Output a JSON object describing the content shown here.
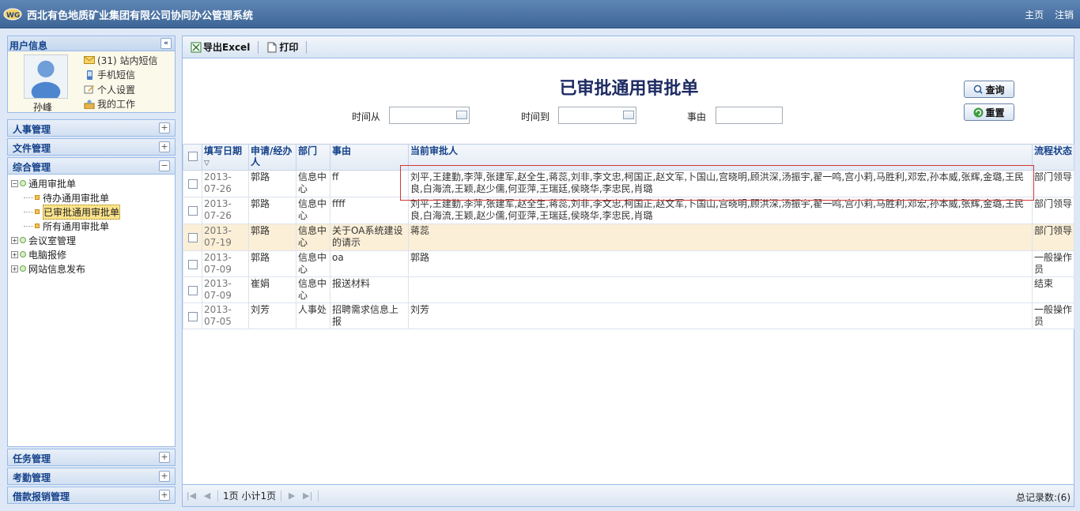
{
  "app": {
    "title": "西北有色地质矿业集团有限公司协同办公管理系统",
    "links": [
      "主页",
      "注销"
    ]
  },
  "user_panel": {
    "header": "用户信息",
    "name": "孙峰",
    "links": [
      "(31) 站内短信",
      "手机短信",
      "个人设置",
      "我的工作"
    ]
  },
  "accordion_top": [
    "人事管理",
    "文件管理",
    "综合管理"
  ],
  "accordion_bottom": [
    "任务管理",
    "考勤管理",
    "借款报销管理"
  ],
  "tree": {
    "root": "通用审批单",
    "children": [
      "待办通用审批单",
      "已审批通用审批单",
      "所有通用审批单"
    ],
    "siblings": [
      "会议室管理",
      "电脑报修",
      "网站信息发布"
    ]
  },
  "toolbar": {
    "export_label": "导出Excel",
    "print_label": "打印"
  },
  "page": {
    "title": "已审批通用审批单"
  },
  "filters": {
    "time_from_label": "时间从",
    "time_to_label": "时间到",
    "reason_label": "事由",
    "time_from": "",
    "time_to": "",
    "reason": ""
  },
  "buttons": {
    "search": "查询",
    "reset": "重置"
  },
  "grid": {
    "columns": [
      "填写日期",
      "申请/经办人",
      "部门",
      "事由",
      "当前审批人",
      "流程状态"
    ],
    "rows": [
      {
        "date": "2013-07-26",
        "applicant": "郭路",
        "dept": "信息中心",
        "reason": "ff",
        "approvers": "刘平,王建勤,李萍,张建军,赵全生,蒋蕊,刘非,李文忠,柯国正,赵文军,卜国山,宫晓明,顾洪深,汤振宇,翟一鸣,宫小莉,马胜利,邓宏,孙本威,张辉,金璐,王民良,白海流,王颖,赵少儒,何亚萍,王瑞廷,侯晓华,李忠民,肖璐",
        "status": "部门领导"
      },
      {
        "date": "2013-07-26",
        "applicant": "郭路",
        "dept": "信息中心",
        "reason": "ffff",
        "approvers": "刘平,王建勤,李萍,张建军,赵全生,蒋蕊,刘非,李文忠,柯国正,赵文军,卜国山,宫晓明,顾洪深,汤振宇,翟一鸣,宫小莉,马胜利,邓宏,孙本威,张辉,金璐,王民良,白海流,王颖,赵少儒,何亚萍,王瑞廷,侯晓华,李忠民,肖璐",
        "status": "部门领导"
      },
      {
        "date": "2013-07-19",
        "applicant": "郭路",
        "dept": "信息中心",
        "reason": "关于OA系统建设的请示",
        "approvers": "蒋蕊",
        "status": "部门领导"
      },
      {
        "date": "2013-07-09",
        "applicant": "郭路",
        "dept": "信息中心",
        "reason": "oa",
        "approvers": "郭路",
        "status": "一般操作员"
      },
      {
        "date": "2013-07-09",
        "applicant": "崔娟",
        "dept": "信息中心",
        "reason": "报送材料",
        "approvers": "",
        "status": "结束"
      },
      {
        "date": "2013-07-05",
        "applicant": "刘芳",
        "dept": "人事处",
        "reason": "招聘需求信息上报",
        "approvers": "刘芳",
        "status": "一般操作员"
      }
    ]
  },
  "pager": {
    "page_info": "1页 小计1页",
    "total": "总记录数:(6)"
  }
}
